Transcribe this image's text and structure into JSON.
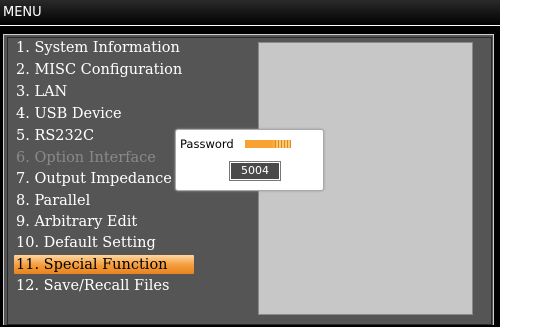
{
  "window": {
    "title": "MENU"
  },
  "menu": {
    "items": [
      {
        "label": "1. System Information",
        "state": "normal"
      },
      {
        "label": "2. MISC Configuration",
        "state": "normal"
      },
      {
        "label": "3. LAN",
        "state": "normal"
      },
      {
        "label": "4. USB Device",
        "state": "normal"
      },
      {
        "label": "5. RS232C",
        "state": "normal"
      },
      {
        "label": "6. Option Interface",
        "state": "disabled"
      },
      {
        "label": "7. Output Impedance",
        "state": "normal"
      },
      {
        "label": "8. Parallel",
        "state": "normal"
      },
      {
        "label": "9. Arbitrary Edit",
        "state": "normal"
      },
      {
        "label": "10. Default Setting",
        "state": "normal"
      },
      {
        "label": "11. Special Function",
        "state": "selected"
      },
      {
        "label": "12. Save/Recall Files",
        "state": "normal"
      }
    ]
  },
  "password_dialog": {
    "label": "Password",
    "value": "5004"
  },
  "colors": {
    "accent_orange": "#f39a3a",
    "panel_gray": "#555555",
    "preview_gray": "#c7c7c7",
    "disabled_text": "#8a8a8a"
  }
}
